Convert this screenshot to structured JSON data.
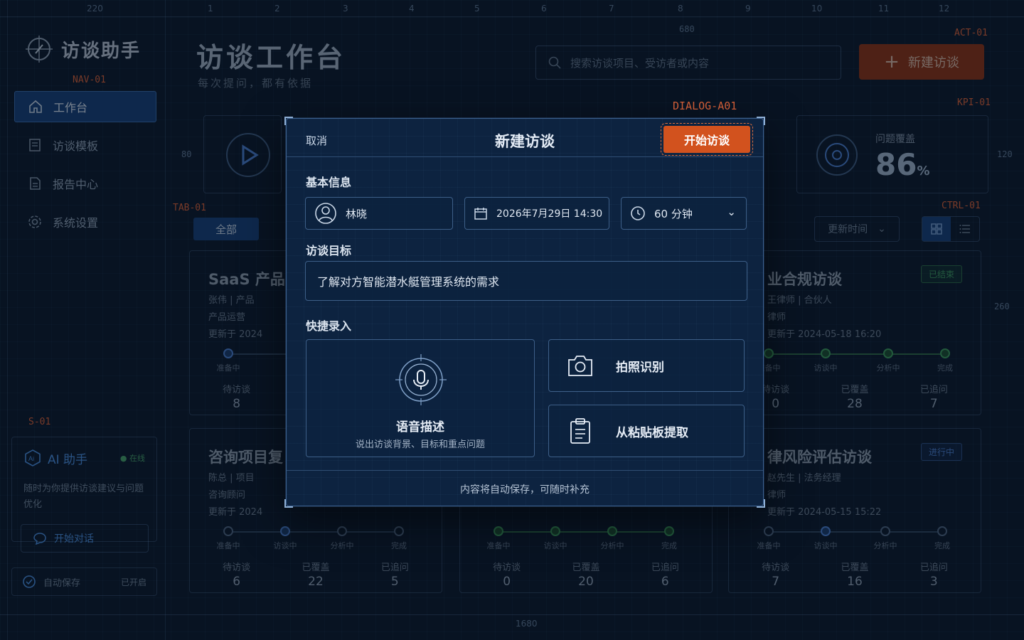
{
  "rulers": {
    "columns": [
      "1",
      "2",
      "3",
      "4",
      "5",
      "6",
      "7",
      "8",
      "9",
      "10",
      "11",
      "12"
    ],
    "sidebar_width": "220",
    "header_width": "680",
    "kpi_height_left": "80",
    "kpi_height_right": "120",
    "card_height": "260",
    "content_width": "1680"
  },
  "annotations": {
    "nav": "NAV-01",
    "tab": "TAB-01",
    "sidebar": "S-01",
    "action": "ACT-01",
    "dialog": "DIALOG-A01",
    "kpi": "KPI-01",
    "control": "CTRL-01"
  },
  "sidebar": {
    "logo": "访谈助手",
    "nav": [
      {
        "label": "工作台",
        "icon": "home-icon",
        "active": true
      },
      {
        "label": "访谈模板",
        "icon": "template-icon",
        "active": false
      },
      {
        "label": "报告中心",
        "icon": "report-icon",
        "active": false
      },
      {
        "label": "系统设置",
        "icon": "gear-icon",
        "active": false
      }
    ],
    "ai": {
      "title": "AI 助手",
      "status": "在线",
      "desc": "随时为你提供访谈建议与问题优化",
      "button": "开始对话"
    },
    "autosave": {
      "label": "自动保存",
      "state": "已开启"
    }
  },
  "header": {
    "title": "访谈工作台",
    "subtitle": "每次提问，都有依据",
    "search_placeholder": "搜索访谈项目、受访者或内容",
    "new_button": "新建访谈"
  },
  "kpi": {
    "coverage_label": "问题覆盖",
    "coverage_value": "86",
    "coverage_unit": "%"
  },
  "filters": {
    "tab_all": "全部",
    "sort": "更新时间"
  },
  "step_labels": [
    "准备中",
    "访谈中",
    "分析中",
    "完成"
  ],
  "stat_labels": [
    "待访谈",
    "已覆盖",
    "已追问"
  ],
  "cards": [
    {
      "title": "SaaS 产品",
      "person": "张伟 | 产品",
      "role": "产品运营",
      "time": "更新于 2024",
      "steps_done": 0,
      "current": 0,
      "stats": [
        "8",
        "",
        ""
      ]
    },
    {
      "title": "业合规访谈",
      "person": "王律师 | 合伙人",
      "role": "律师",
      "time": "更新于 2024-05-18 16:20",
      "badge": "已结束",
      "badge_type": "done",
      "steps_done": 4,
      "current": -1,
      "stats": [
        "0",
        "28",
        "7"
      ]
    },
    {
      "title": "咨询项目复",
      "person": "陈总 | 项目",
      "role": "咨询顾问",
      "time": "更新于 2024",
      "steps_done": 0,
      "current": 1,
      "stats": [
        "6",
        "22",
        "5"
      ]
    },
    {
      "title": "",
      "person": "",
      "role": "",
      "time": "",
      "steps_done": 4,
      "current": -1,
      "stats": [
        "0",
        "20",
        "6"
      ]
    },
    {
      "title": "律风险评估访谈",
      "person": "赵先生 | 法务经理",
      "role": "律师",
      "time": "更新于 2024-05-15 15:22",
      "badge": "进行中",
      "badge_type": "prog",
      "steps_done": 0,
      "current": 1,
      "stats": [
        "7",
        "16",
        "3"
      ]
    }
  ],
  "dialog": {
    "cancel": "取消",
    "title": "新建访谈",
    "start": "开始访谈",
    "basic_label": "基本信息",
    "interviewee": "林晓",
    "datetime": "2026年7月29日 14:30",
    "duration": "60 分钟",
    "goal_label": "访谈目标",
    "goal_value": "了解对方智能潜水艇管理系统的需求",
    "quick_label": "快捷录入",
    "voice_title": "语音描述",
    "voice_sub": "说出访谈背景、目标和重点问题",
    "photo": "拍照识别",
    "clipboard": "从粘贴板提取",
    "footer": "内容将自动保存，可随时补充"
  },
  "colors": {
    "accent": "#d2521e",
    "primary": "#17407a",
    "success": "#3b9a5e",
    "background": "#0b1a2e"
  }
}
